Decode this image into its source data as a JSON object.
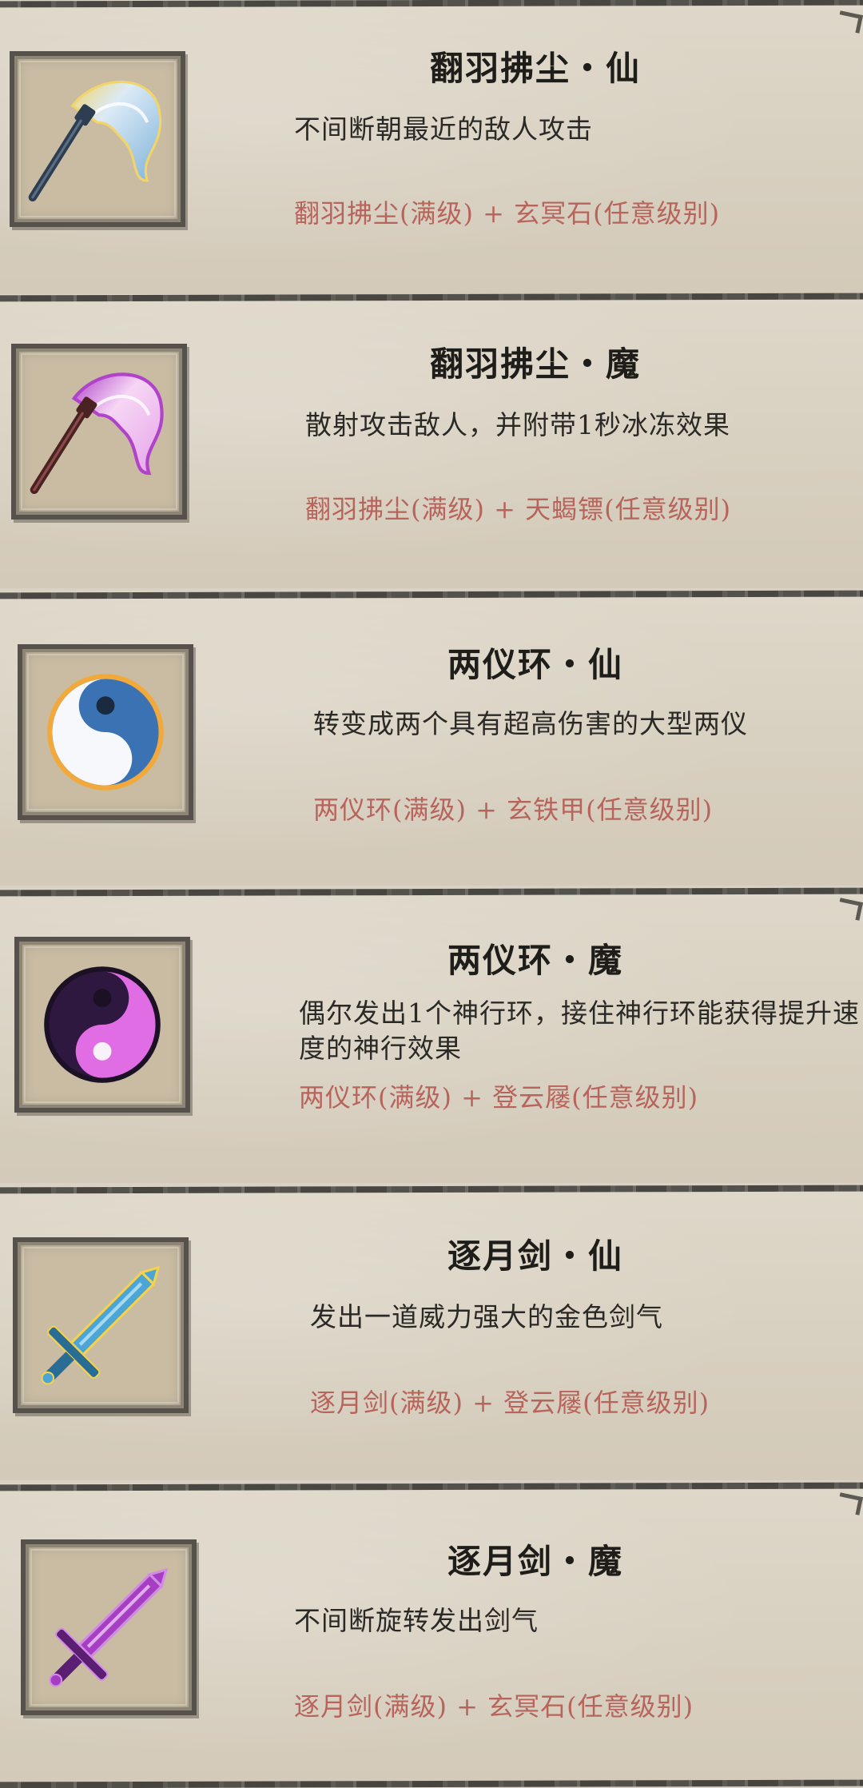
{
  "items": [
    {
      "title": "翻羽拂尘・仙",
      "description": "不间断朝最近的敌人攻击",
      "recipe": "翻羽拂尘(满级) + 玄冥石(任意级别)",
      "icon": "feather-duster-blue-icon",
      "colors": {
        "primary": "#7fb3d9",
        "accent": "#f1d46a",
        "handle": "#2d3e52"
      }
    },
    {
      "title": "翻羽拂尘・魔",
      "description": "散射攻击敌人，并附带1秒冰冻效果",
      "recipe": "翻羽拂尘(满级) + 天蝎镖(任意级别)",
      "icon": "feather-duster-purple-icon",
      "colors": {
        "primary": "#e6a3e8",
        "accent": "#b043c9",
        "handle": "#4a2222"
      }
    },
    {
      "title": "两仪环・仙",
      "description": "转变成两个具有超高伤害的大型两仪",
      "recipe": "两仪环(满级) + 玄铁甲(任意级别)",
      "icon": "yin-yang-blue-icon",
      "colors": {
        "light": "#f6f8fb",
        "dark": "#3a72b4",
        "rim": "#f0a93a"
      }
    },
    {
      "title": "两仪环・魔",
      "description": "偶尔发出1个神行环，接住神行环能获得提升速度的神行效果",
      "recipe": "两仪环(满级) + 登云屦(任意级别)",
      "icon": "yin-yang-purple-icon",
      "colors": {
        "light": "#e06de4",
        "dark": "#2e1840",
        "rim": "#1b1024"
      }
    },
    {
      "title": "逐月剑・仙",
      "description": "发出一道威力强大的金色剑气",
      "recipe": "逐月剑(满级) + 登云屦(任意级别)",
      "icon": "sword-blue-icon",
      "colors": {
        "blade": "#4ba6d6",
        "glow": "#f3d24e",
        "hilt": "#2a6d94"
      }
    },
    {
      "title": "逐月剑・魔",
      "description": "不间断旋转发出剑气",
      "recipe": "逐月剑(满级) + 玄冥石(任意级别)",
      "icon": "sword-purple-icon",
      "colors": {
        "blade": "#a53ec2",
        "glow": "#d38be6",
        "hilt": "#5a1f72"
      }
    }
  ]
}
